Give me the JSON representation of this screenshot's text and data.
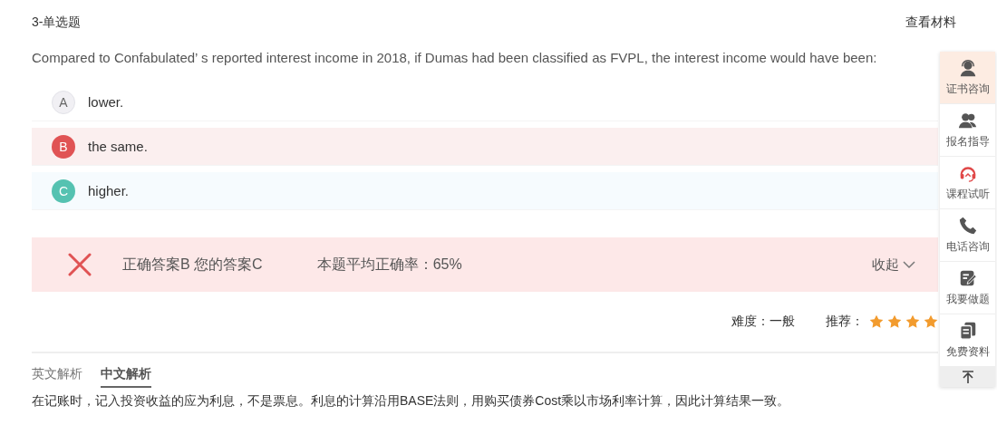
{
  "header": {
    "question_type": "3-单选题",
    "material_link": "查看材料"
  },
  "question": "Compared to Confabulated’ s reported interest income in 2018, if Dumas had been classified as FVPL, the interest income would have been:",
  "options": [
    {
      "letter": "A",
      "text": "lower.",
      "kind": "plain"
    },
    {
      "letter": "B",
      "text": "the same.",
      "kind": "correct"
    },
    {
      "letter": "C",
      "text": "higher.",
      "kind": "chosen"
    }
  ],
  "result": {
    "correct": false,
    "answers": "正确答案B 您的答案C",
    "average": "本题平均正确率：65%",
    "collapse": "收起"
  },
  "rating": {
    "difficulty": "难度：一般",
    "recommend_label": "推荐：",
    "stars": 4
  },
  "tabs": [
    {
      "label": "英文解析",
      "selected": false
    },
    {
      "label": "中文解析",
      "selected": true
    }
  ],
  "explanation": "在记账时，记入投资收益的应为利息，不是票息。利息的计算沿用BASE法则，用购买债券Cost乘以市场利率计算，因此计算结果一致。",
  "sidebar": [
    {
      "label": "证书咨询",
      "selected": true
    },
    {
      "label": "报名指导",
      "selected": false
    },
    {
      "label": "课程试听",
      "selected": false
    },
    {
      "label": "电话咨询",
      "selected": false
    },
    {
      "label": "我要做题",
      "selected": false
    },
    {
      "label": "免费资料",
      "selected": false
    }
  ]
}
